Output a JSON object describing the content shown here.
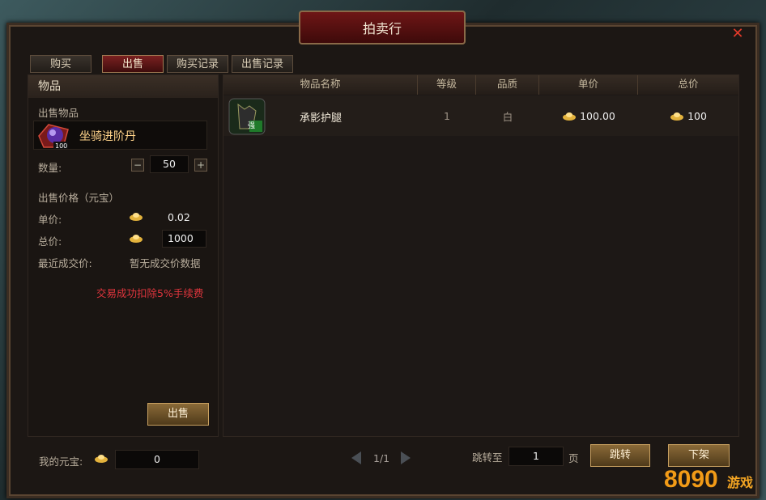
{
  "window": {
    "title": "拍卖行"
  },
  "tabs": [
    {
      "label": "购买",
      "active": false
    },
    {
      "label": "出售",
      "active": true
    },
    {
      "label": "购买记录",
      "active": false
    },
    {
      "label": "出售记录",
      "active": false
    }
  ],
  "left": {
    "header": "物品",
    "sell_item_label": "出售物品",
    "item_name": "坐骑进阶丹",
    "item_badge": "100",
    "qty_label": "数量:",
    "qty_value": "50",
    "price_section": "出售价格（元宝）",
    "unit_label": "单价:",
    "unit_value": "0.02",
    "total_label": "总价:",
    "total_value": "1000",
    "recent_label": "最近成交价:",
    "recent_value": "暂无成交价数据",
    "fee_notice": "交易成功扣除5%手续费",
    "sell_button": "出售"
  },
  "table": {
    "headers": [
      "物品名称",
      "等级",
      "品质",
      "单价",
      "总价"
    ],
    "rows": [
      {
        "name": "承影护腿",
        "level": "1",
        "quality": "白",
        "unit_price": "100.00",
        "total_price": "100",
        "icon_badge": "强"
      }
    ]
  },
  "footer": {
    "my_ingot_label": "我的元宝:",
    "my_ingot_value": "0",
    "page_indicator": "1/1",
    "jump_label": "跳转至",
    "jump_value": "1",
    "page_unit": "页",
    "jump_button": "跳转",
    "delist_button": "下架"
  },
  "logo": {
    "text": "8090游戏"
  },
  "colors": {
    "accent_red": "#e0353d",
    "item_gold": "#ffd38a",
    "button_gold": "#8a6a38"
  }
}
